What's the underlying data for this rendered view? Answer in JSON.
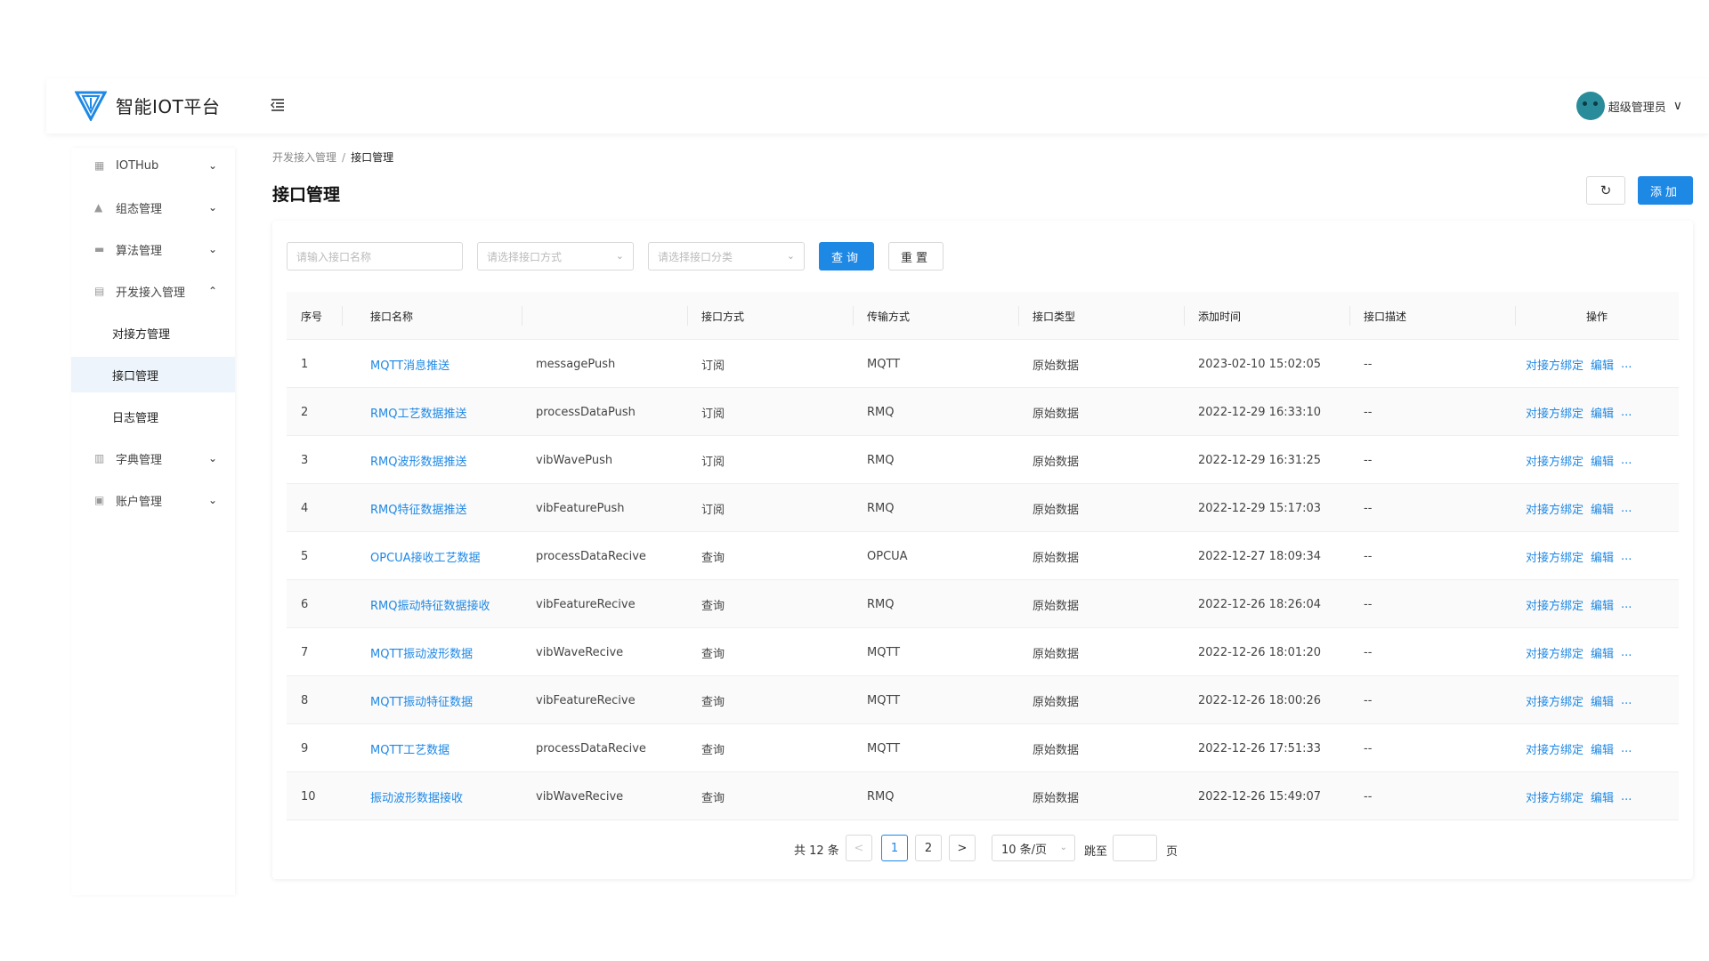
{
  "app": {
    "title": "智能IOT平台"
  },
  "user": {
    "name": "超级管理员"
  },
  "sidebar": {
    "items": [
      {
        "label": "IOTHub",
        "icon": "grid-icon"
      },
      {
        "label": "组态管理",
        "icon": "layers-icon"
      },
      {
        "label": "算法管理",
        "icon": "card-icon"
      },
      {
        "label": "开发接入管理",
        "icon": "code-icon"
      },
      {
        "label": "字典管理",
        "icon": "chart-icon"
      },
      {
        "label": "账户管理",
        "icon": "id-icon"
      }
    ],
    "sub_items": [
      {
        "label": "对接方管理"
      },
      {
        "label": "接口管理"
      },
      {
        "label": "日志管理"
      }
    ]
  },
  "breadcrumb": {
    "parent": "开发接入管理",
    "separator": "/",
    "current": "接口管理"
  },
  "page": {
    "title": "接口管理",
    "add_label": "添加"
  },
  "filters": {
    "name_placeholder": "请输入接口名称",
    "method_placeholder": "请选择接口方式",
    "category_placeholder": "请选择接口分类",
    "query_label": "查询",
    "reset_label": "重置"
  },
  "table": {
    "headers": [
      "序号",
      "接口名称",
      "",
      "接口方式",
      "传输方式",
      "接口类型",
      "添加时间",
      "接口描述",
      "操作"
    ],
    "rows": [
      {
        "no": "1",
        "name": "MQTT消息推送",
        "code": "messagePush",
        "method": "订阅",
        "transport": "MQTT",
        "type": "原始数据",
        "time": "2023-02-10 15:02:05",
        "desc": "--"
      },
      {
        "no": "2",
        "name": "RMQ工艺数据推送",
        "code": "processDataPush",
        "method": "订阅",
        "transport": "RMQ",
        "type": "原始数据",
        "time": "2022-12-29 16:33:10",
        "desc": "--"
      },
      {
        "no": "3",
        "name": "RMQ波形数据推送",
        "code": "vibWavePush",
        "method": "订阅",
        "transport": "RMQ",
        "type": "原始数据",
        "time": "2022-12-29 16:31:25",
        "desc": "--"
      },
      {
        "no": "4",
        "name": "RMQ特征数据推送",
        "code": "vibFeaturePush",
        "method": "订阅",
        "transport": "RMQ",
        "type": "原始数据",
        "time": "2022-12-29 15:17:03",
        "desc": "--"
      },
      {
        "no": "5",
        "name": "OPCUA接收工艺数据",
        "code": "processDataRecive",
        "method": "查询",
        "transport": "OPCUA",
        "type": "原始数据",
        "time": "2022-12-27 18:09:34",
        "desc": "--"
      },
      {
        "no": "6",
        "name": "RMQ振动特征数据接收",
        "code": "vibFeatureRecive",
        "method": "查询",
        "transport": "RMQ",
        "type": "原始数据",
        "time": "2022-12-26 18:26:04",
        "desc": "--"
      },
      {
        "no": "7",
        "name": "MQTT振动波形数据",
        "code": "vibWaveRecive",
        "method": "查询",
        "transport": "MQTT",
        "type": "原始数据",
        "time": "2022-12-26 18:01:20",
        "desc": "--"
      },
      {
        "no": "8",
        "name": "MQTT振动特征数据",
        "code": "vibFeatureRecive",
        "method": "查询",
        "transport": "MQTT",
        "type": "原始数据",
        "time": "2022-12-26 18:00:26",
        "desc": "--"
      },
      {
        "no": "9",
        "name": "MQTT工艺数据",
        "code": "processDataRecive",
        "method": "查询",
        "transport": "MQTT",
        "type": "原始数据",
        "time": "2022-12-26 17:51:33",
        "desc": "--"
      },
      {
        "no": "10",
        "name": "振动波形数据接收",
        "code": "vibWaveRecive",
        "method": "查询",
        "transport": "RMQ",
        "type": "原始数据",
        "time": "2022-12-26 15:49:07",
        "desc": "--"
      }
    ],
    "actions": {
      "bind": "对接方绑定",
      "edit": "编辑",
      "more": "..."
    }
  },
  "pagination": {
    "total_text": "共 12 条",
    "prev": "<",
    "next": ">",
    "pages": [
      "1",
      "2"
    ],
    "current": "1",
    "page_size": "10 条/页",
    "jump_label": "跳至",
    "page_label": "页"
  },
  "colors": {
    "accent": "#1e88e5"
  }
}
